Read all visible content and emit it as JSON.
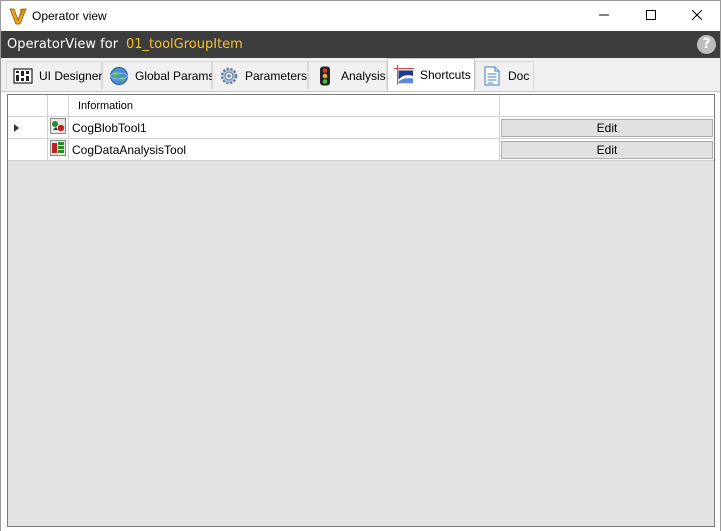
{
  "window": {
    "title": "Operator view"
  },
  "header": {
    "label": "OperatorView  for",
    "item_name": "01_toolGroupItem",
    "help_symbol": "?"
  },
  "tabs": [
    {
      "label": "UI Designer",
      "icon": "ui-designer-icon"
    },
    {
      "label": "Global Params",
      "icon": "globe-icon"
    },
    {
      "label": "Parameters",
      "icon": "gear-icon"
    },
    {
      "label": "Analysis",
      "icon": "traffic-light-icon"
    },
    {
      "label": "Shortcuts",
      "icon": "shortcuts-icon",
      "active": true
    },
    {
      "label": "Doc",
      "icon": "document-icon"
    }
  ],
  "grid": {
    "columns": {
      "information": "Information"
    },
    "rows": [
      {
        "name": "CogBlobTool1",
        "button": "Edit",
        "icon": "blob-tool-icon",
        "current": true
      },
      {
        "name": "CogDataAnalysisTool",
        "button": "Edit",
        "icon": "data-analysis-tool-icon",
        "current": false
      }
    ]
  },
  "colors": {
    "header_band": "#3d3d3d",
    "item_highlight": "#f2c230",
    "grid_background": "#e3e3e3"
  }
}
